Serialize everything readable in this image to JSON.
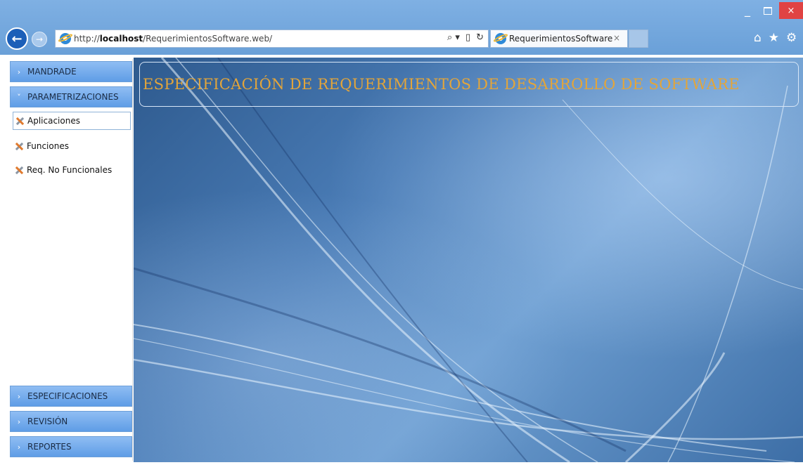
{
  "browser": {
    "address_prefix": "http://",
    "address_host": "localhost",
    "address_path": "/RequerimientosSoftware.web/",
    "tab_title": "RequerimientosSoftware",
    "tab_close": "×",
    "search_glyph": "⌕",
    "window_close": "×"
  },
  "sidebar": {
    "top_sections": [
      {
        "label": "MANDRADE"
      },
      {
        "label": "PARAMETRIZACIONES"
      }
    ],
    "sub_items": [
      {
        "label": "Aplicaciones"
      },
      {
        "label": "Funciones"
      },
      {
        "label": "Req. No Funcionales"
      }
    ],
    "bottom_sections": [
      {
        "label": "ESPECIFICACIONES"
      },
      {
        "label": "REVISIÓN"
      },
      {
        "label": "REPORTES"
      }
    ]
  },
  "content": {
    "title": "ESPECIFICACIÓN DE REQUERIMIENTOS DE DESARROLLO DE SOFTWARE",
    "title_color": "#e3a53a"
  }
}
